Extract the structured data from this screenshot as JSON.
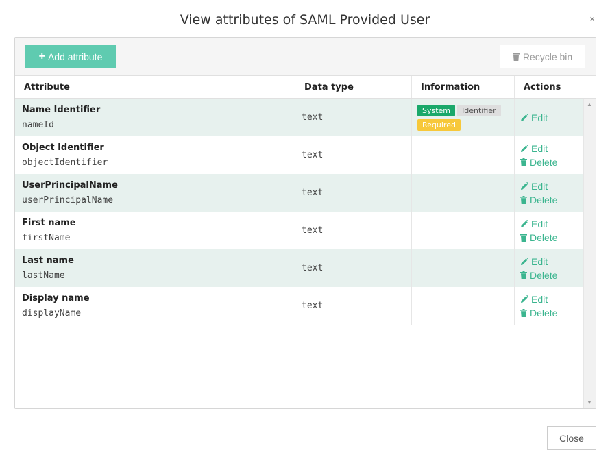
{
  "dialog": {
    "title": "View attributes of SAML Provided User",
    "close_glyph": "×",
    "close_button": "Close"
  },
  "toolbar": {
    "add_label": "Add attribute",
    "add_icon": "plus-icon",
    "recycle_label": "Recycle bin",
    "recycle_icon": "trash-icon"
  },
  "table": {
    "headers": {
      "attribute": "Attribute",
      "data_type": "Data type",
      "information": "Information",
      "actions": "Actions"
    },
    "rows": [
      {
        "name": "Name Identifier",
        "key": "nameId",
        "type": "text",
        "badges": [
          "System",
          "Identifier",
          "Required"
        ],
        "actions": [
          "Edit"
        ]
      },
      {
        "name": "Object Identifier",
        "key": "objectIdentifier",
        "type": "text",
        "badges": [],
        "actions": [
          "Edit",
          "Delete"
        ]
      },
      {
        "name": "UserPrincipalName",
        "key": "userPrincipalName",
        "type": "text",
        "badges": [],
        "actions": [
          "Edit",
          "Delete"
        ]
      },
      {
        "name": "First name",
        "key": "firstName",
        "type": "text",
        "badges": [],
        "actions": [
          "Edit",
          "Delete"
        ]
      },
      {
        "name": "Last name",
        "key": "lastName",
        "type": "text",
        "badges": [],
        "actions": [
          "Edit",
          "Delete"
        ]
      },
      {
        "name": "Display name",
        "key": "displayName",
        "type": "text",
        "badges": [],
        "actions": [
          "Edit",
          "Delete"
        ]
      }
    ]
  },
  "colors": {
    "accent": "#5fcbb0",
    "action": "#3bb58f",
    "system_badge": "#1aa86a",
    "identifier_badge": "#dedede",
    "required_badge": "#f7c83a",
    "row_alt": "#e7f1ee"
  }
}
